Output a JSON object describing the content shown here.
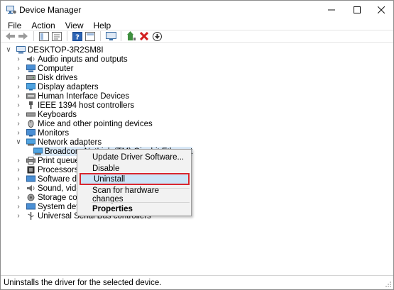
{
  "window": {
    "title": "Device Manager"
  },
  "menu": [
    "File",
    "Action",
    "View",
    "Help"
  ],
  "toolbar": [
    "back-arrow-icon",
    "forward-arrow-icon",
    "tree-view-icon",
    "properties-icon",
    "help-icon",
    "list-view-icon",
    "monitor-icon",
    "update-driver-icon",
    "uninstall-x-icon",
    "scan-download-icon"
  ],
  "tree": {
    "root": "DESKTOP-3R2SM8I",
    "items": [
      "Audio inputs and outputs",
      "Computer",
      "Disk drives",
      "Display adapters",
      "Human Interface Devices",
      "IEEE 1394 host controllers",
      "Keyboards",
      "Mice and other pointing devices",
      "Monitors",
      "Network adapters",
      "Broadcom NetLink (TM) Gigabit Ethernet",
      "Print queues",
      "Processors",
      "Software devices",
      "Sound, video and game controllers",
      "Storage controllers",
      "System devices",
      "Universal Serial Bus controllers"
    ]
  },
  "context_menu": {
    "update": "Update Driver Software...",
    "disable": "Disable",
    "uninstall": "Uninstall",
    "scan": "Scan for hardware changes",
    "properties": "Properties"
  },
  "status": "Uninstalls the driver for the selected device.",
  "colors": {
    "highlight": "#cce4f7",
    "outline": "#d9262e",
    "menu_bg": "#f2f2f2"
  }
}
